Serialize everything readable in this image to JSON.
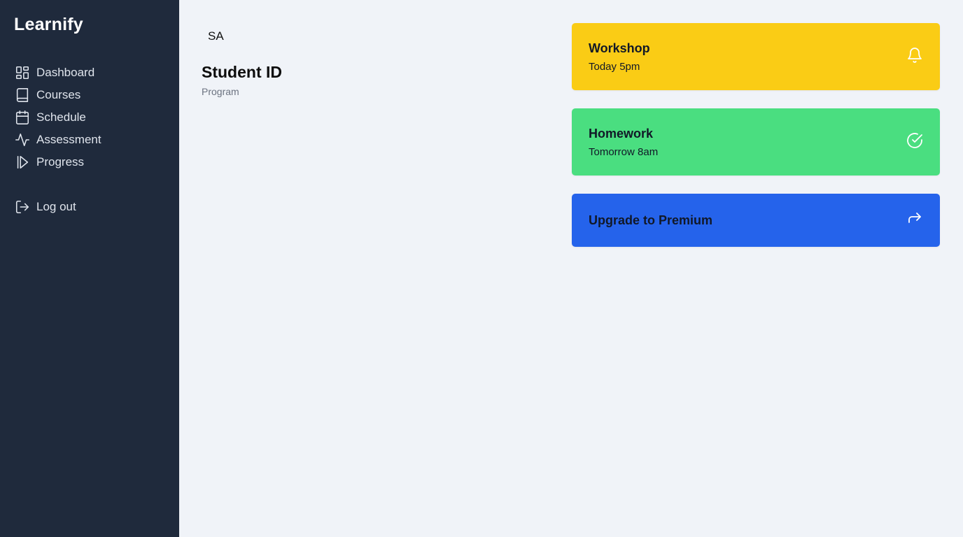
{
  "app": {
    "brand": "Learnify"
  },
  "sidebar": {
    "items": [
      {
        "label": "Dashboard",
        "icon": "dashboard-icon"
      },
      {
        "label": "Courses",
        "icon": "book-icon"
      },
      {
        "label": "Schedule",
        "icon": "calendar-icon"
      },
      {
        "label": "Assessment",
        "icon": "activity-icon"
      },
      {
        "label": "Progress",
        "icon": "progress-icon"
      }
    ],
    "logout": {
      "label": "Log out",
      "icon": "logout-icon"
    }
  },
  "profile": {
    "initials": "SA",
    "title": "Student ID",
    "subtitle": "Program"
  },
  "cards": [
    {
      "title": "Workshop",
      "subtitle": "Today 5pm",
      "icon": "bell-icon",
      "color": "#facc15"
    },
    {
      "title": "Homework",
      "subtitle": "Tomorrow 8am",
      "icon": "check-circle-icon",
      "color": "#4ade80"
    },
    {
      "title": "Upgrade to Premium",
      "icon": "forward-arrow-icon",
      "color": "#2563eb"
    }
  ],
  "colors": {
    "sidebar_bg": "#1f2a3c",
    "main_bg": "#f0f3f8"
  }
}
